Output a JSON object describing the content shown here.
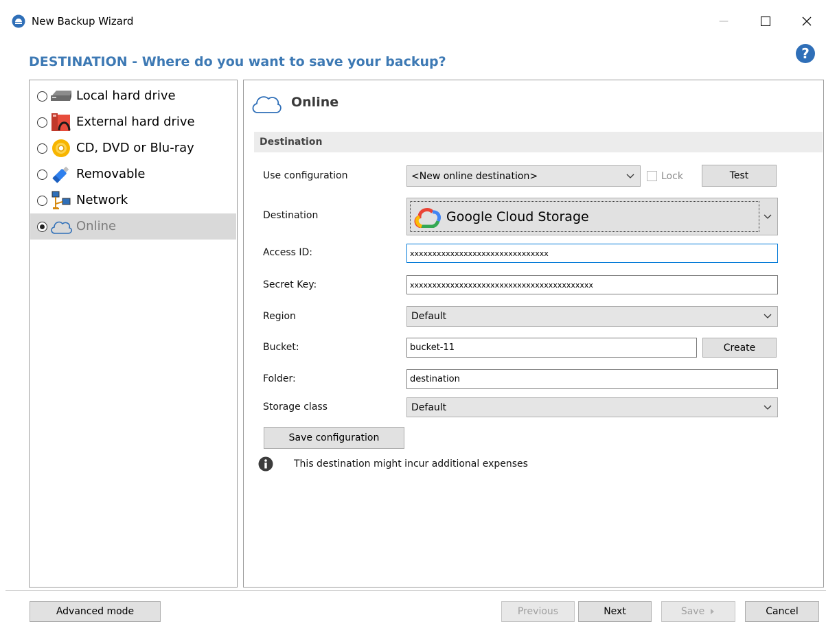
{
  "window": {
    "title": "New Backup Wizard",
    "minimize_glyph": "—",
    "maximize_glyph": "☐",
    "close_glyph": "✕"
  },
  "heading": "DESTINATION - Where do you want to save your backup?",
  "help_icon": "?",
  "destinations": [
    {
      "label": "Local hard drive",
      "icon": "hard-drive-icon",
      "selected": false
    },
    {
      "label": "External hard drive",
      "icon": "external-drive-icon",
      "selected": false
    },
    {
      "label": "CD, DVD or Blu-ray",
      "icon": "disc-icon",
      "selected": false
    },
    {
      "label": "Removable",
      "icon": "usb-drive-icon",
      "selected": false
    },
    {
      "label": "Network",
      "icon": "network-icon",
      "selected": false
    },
    {
      "label": "Online",
      "icon": "cloud-icon",
      "selected": true
    }
  ],
  "panel": {
    "title": "Online",
    "section": "Destination"
  },
  "form": {
    "use_configuration_label": "Use configuration",
    "use_configuration_value": "<New online destination>",
    "lock_label": "Lock",
    "test_button": "Test",
    "destination_label": "Destination",
    "destination_value": "Google Cloud Storage",
    "access_id_label": "Access ID:",
    "access_id_value": "xxxxxxxxxxxxxxxxxxxxxxxxxxxxxxx",
    "secret_key_label": "Secret Key:",
    "secret_key_value": "xxxxxxxxxxxxxxxxxxxxxxxxxxxxxxxxxxxxxxxxx",
    "region_label": "Region",
    "region_value": "Default",
    "bucket_label": "Bucket:",
    "bucket_value": "bucket-11",
    "create_button": "Create",
    "folder_label": "Folder:",
    "folder_value": "destination",
    "storage_class_label": "Storage class",
    "storage_class_value": "Default",
    "save_config_button": "Save configuration"
  },
  "info": {
    "icon": "info-icon",
    "text": "This destination might incur additional expenses"
  },
  "footer": {
    "advanced_mode": "Advanced mode",
    "previous": "Previous",
    "next": "Next",
    "save": "Save",
    "cancel": "Cancel"
  },
  "colors": {
    "heading": "#3d79b4",
    "selected_row": "#d9d9d9",
    "focus_border": "#0078d7"
  }
}
